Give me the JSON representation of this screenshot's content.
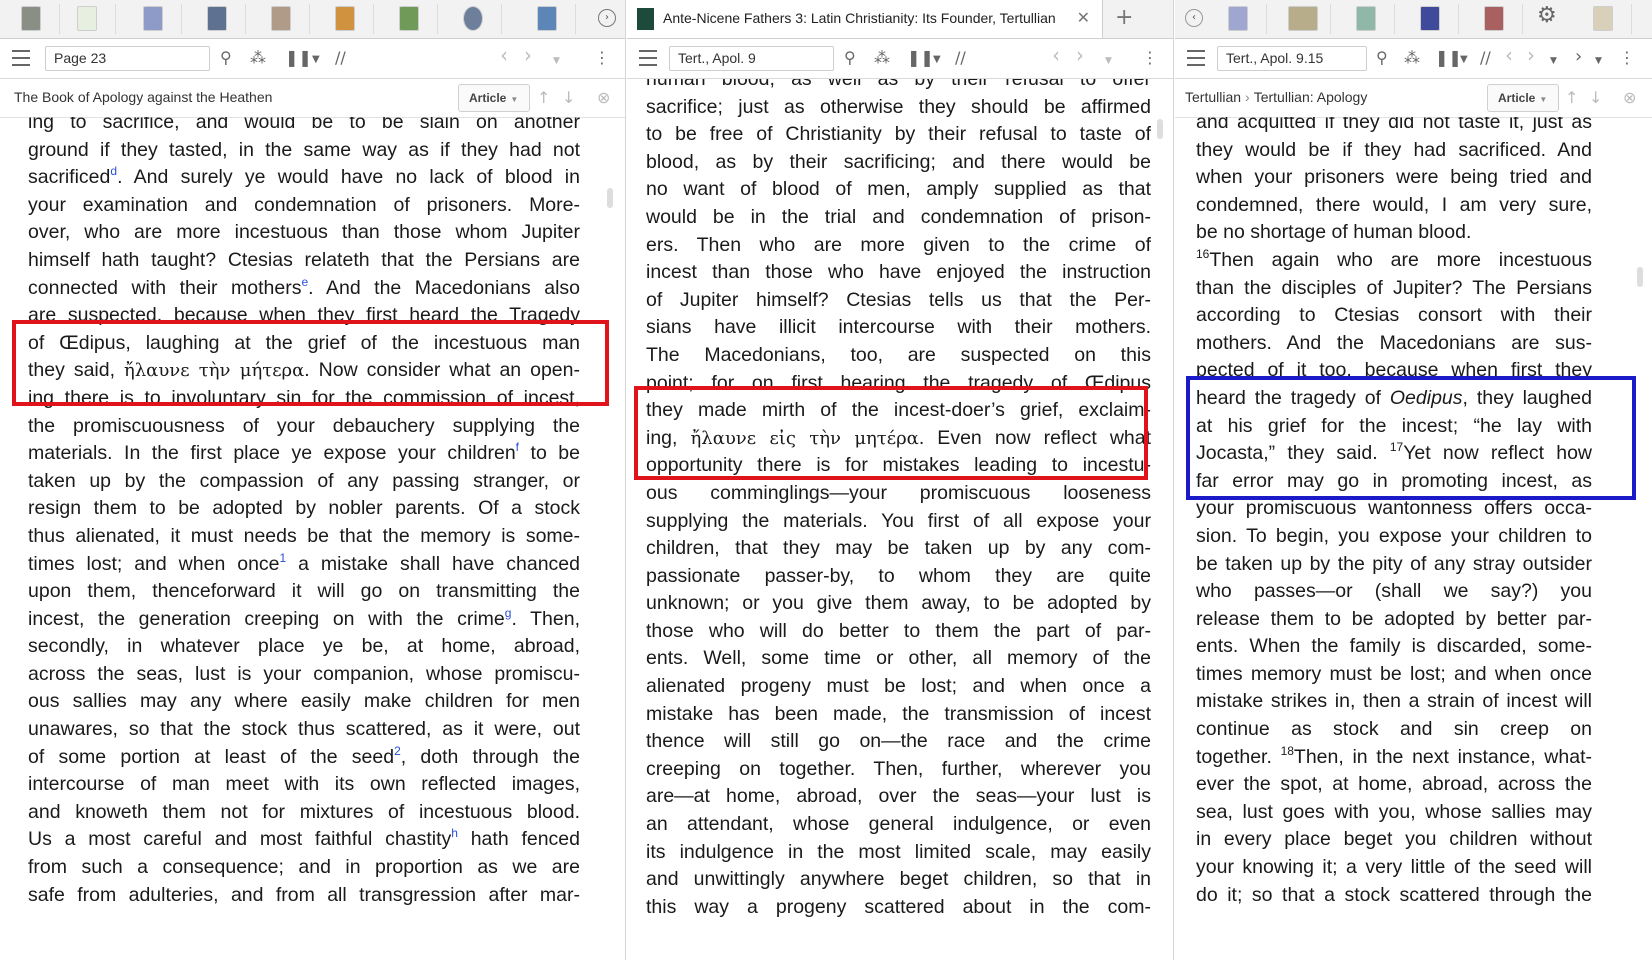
{
  "left": {
    "reference": "Page 23",
    "header_title": "The Book of Apology against the Heathen",
    "view_label": "Article",
    "lines": [
      [
        {
          "t": "ing to sacrifice, and would be to be slain on another"
        }
      ],
      [
        {
          "t": "ground if they tasted, in the same way as if they had not"
        }
      ],
      [
        {
          "t": "sacrificed"
        },
        {
          "t": "d",
          "sup": true
        },
        {
          "t": ". And surely ye would have no lack of blood in"
        }
      ],
      [
        {
          "t": "your examination and condemnation of prisoners. More-"
        }
      ],
      [
        {
          "t": "over, who are more incestuous than those whom Jupiter"
        }
      ],
      [
        {
          "t": "himself hath taught? Ctesias relateth that the Persians are"
        }
      ],
      [
        {
          "t": "connected with their mothers"
        },
        {
          "t": "e",
          "sup": true
        },
        {
          "t": ". And the Macedonians also"
        }
      ],
      [
        {
          "t": "are suspected, because when they first heard the Tragedy"
        }
      ],
      [
        {
          "t": "of Œdipus, laughing at the grief of the incestuous man"
        }
      ],
      [
        {
          "t": "they said, "
        },
        {
          "t": "ἤλαυνε τὴν μήτερα",
          "greek": true
        },
        {
          "t": ". Now consider what an open-"
        }
      ],
      [
        {
          "t": "ing there is to involuntary sin for the commission of incest,"
        }
      ],
      [
        {
          "t": "the promiscuousness of your debauchery supplying the"
        }
      ],
      [
        {
          "t": "materials. In the first place ye expose your children"
        },
        {
          "t": "f",
          "sup": true
        },
        {
          "t": " to be"
        }
      ],
      [
        {
          "t": "taken up by the compassion of any passing stranger, or"
        }
      ],
      [
        {
          "t": "resign them to be adopted by nobler parents. Of a stock"
        }
      ],
      [
        {
          "t": "thus alienated, it must needs be that the memory is some-"
        }
      ],
      [
        {
          "t": "times lost; and when once"
        },
        {
          "t": "1",
          "sup": true
        },
        {
          "t": " a mistake shall have chanced"
        }
      ],
      [
        {
          "t": "upon them, thenceforward it will go on transmitting the"
        }
      ],
      [
        {
          "t": "incest, the generation creeping on with the crime"
        },
        {
          "t": "g",
          "sup": true
        },
        {
          "t": ". Then,"
        }
      ],
      [
        {
          "t": "secondly, in whatever place ye be, at home, abroad,"
        }
      ],
      [
        {
          "t": "across the seas, lust is your companion, whose promiscu-"
        }
      ],
      [
        {
          "t": "ous sallies may any where easily make children for men"
        }
      ],
      [
        {
          "t": "unawares, so that the stock thus scattered, as it were, out"
        }
      ],
      [
        {
          "t": "of some portion at least of the seed"
        },
        {
          "t": "2",
          "sup": true
        },
        {
          "t": ", doth through the"
        }
      ],
      [
        {
          "t": "intercourse of man meet with its own reflected images,"
        }
      ],
      [
        {
          "t": "and knoweth them not for mixtures of incestuous blood."
        }
      ],
      [
        {
          "t": "Us a most careful and most faithful chastity"
        },
        {
          "t": "h",
          "sup": true
        },
        {
          "t": " hath fenced"
        }
      ],
      [
        {
          "t": "from such a consequence; and in proportion as we are"
        }
      ],
      [
        {
          "t": "safe from adulteries, and from all transgression after mar-"
        }
      ]
    ]
  },
  "middle": {
    "tab_title": "Ante-Nicene Fathers 3: Latin Christianity: Its Founder, Tertullian",
    "reference": "Tert., Apol. 9",
    "lines": [
      [
        {
          "t": "human blood, as well as by their refusal to offer"
        }
      ],
      [
        {
          "t": "sacrifice; just as otherwise they should be affirmed"
        }
      ],
      [
        {
          "t": "to be free of Christianity by their refusal to taste of"
        }
      ],
      [
        {
          "t": "blood, as by their sacrificing; and there would be"
        }
      ],
      [
        {
          "t": "no want of blood of men, amply supplied as that"
        }
      ],
      [
        {
          "t": "would be in the trial and condemnation of prison-"
        }
      ],
      [
        {
          "t": "ers. Then who are more given to the crime of"
        }
      ],
      [
        {
          "t": "incest than those who have enjoyed the instruction"
        }
      ],
      [
        {
          "t": "of Jupiter himself? Ctesias tells us that the Per-"
        }
      ],
      [
        {
          "t": "sians have illicit intercourse with their mothers."
        }
      ],
      [
        {
          "t": "The Macedonians, too, are suspected on this"
        }
      ],
      [
        {
          "t": "point; for on first hearing the tragedy of Œdipus"
        }
      ],
      [
        {
          "t": "they made mirth of the incest-doer’s grief, exclaim-"
        }
      ],
      [
        {
          "t": "ing, "
        },
        {
          "t": "ἤλαυνε εἰς τὴν μητέρα",
          "greek": true
        },
        {
          "t": ". Even now reflect what"
        }
      ],
      [
        {
          "t": "opportunity there is for mistakes leading to incestu-"
        }
      ],
      [
        {
          "t": "ous comminglings—your promiscuous looseness"
        }
      ],
      [
        {
          "t": "supplying the materials. You first of all expose your"
        }
      ],
      [
        {
          "t": "children, that they may be taken up by any com-"
        }
      ],
      [
        {
          "t": "passionate passer-by, to whom they are quite"
        }
      ],
      [
        {
          "t": "unknown; or you give them away, to be adopted by"
        }
      ],
      [
        {
          "t": "those who will do better to them the part of par-"
        }
      ],
      [
        {
          "t": "ents. Well, some time or other, all memory of the"
        }
      ],
      [
        {
          "t": "alienated progeny must be lost; and when once a"
        }
      ],
      [
        {
          "t": "mistake has been made, the transmission of incest"
        }
      ],
      [
        {
          "t": "thence will still go on—the race and the crime"
        }
      ],
      [
        {
          "t": "creeping on together. Then, further, wherever you"
        }
      ],
      [
        {
          "t": "are—at home, abroad, over the seas—your lust is"
        }
      ],
      [
        {
          "t": "an attendant, whose general indulgence, or even"
        }
      ],
      [
        {
          "t": "its indulgence in the most limited scale, may easily"
        }
      ],
      [
        {
          "t": "and unwittingly anywhere beget children, so that in"
        }
      ],
      [
        {
          "t": "this way a progeny scattered about in the com-"
        }
      ]
    ]
  },
  "right": {
    "reference": "Tert., Apol. 9.15",
    "breadcrumb": [
      "Tertullian",
      "Tertullian: Apology"
    ],
    "view_label": "Article",
    "lines": [
      [
        {
          "t": "and acquitted if they did not taste it, just as"
        }
      ],
      [
        {
          "t": "they would be if they had sacrificed. And"
        }
      ],
      [
        {
          "t": "when your prisoners were being tried and"
        }
      ],
      [
        {
          "t": "condemned, there would, I am very sure,"
        }
      ],
      [
        {
          "t": "be no shortage of human blood.",
          "last": true
        }
      ],
      [
        {
          "t": "16",
          "sup": true,
          "plain": true
        },
        {
          "t": "Then again who are more incestuous"
        }
      ],
      [
        {
          "t": "than the disciples of Jupiter? The Persians"
        }
      ],
      [
        {
          "t": "according to Ctesias consort with their"
        }
      ],
      [
        {
          "t": "mothers. And the Macedonians are sus-"
        }
      ],
      [
        {
          "t": "pected of it too, because when first they"
        }
      ],
      [
        {
          "t": "heard the tragedy of "
        },
        {
          "t": "Oedipus",
          "it": true
        },
        {
          "t": ", they laughed"
        }
      ],
      [
        {
          "t": "at his grief for the incest; “he lay with"
        }
      ],
      [
        {
          "t": "Jocasta,” they said. "
        },
        {
          "t": "17",
          "sup": true,
          "plain": true
        },
        {
          "t": "Yet now reflect how"
        }
      ],
      [
        {
          "t": "far error may go in promoting incest, as"
        }
      ],
      [
        {
          "t": "your promiscuous wantonness offers occa-"
        }
      ],
      [
        {
          "t": "sion. To begin, you expose your children to"
        }
      ],
      [
        {
          "t": "be taken up by the pity of any stray outsider"
        }
      ],
      [
        {
          "t": "who passes—or (shall we say?) you"
        }
      ],
      [
        {
          "t": "release them to be adopted by better par-"
        }
      ],
      [
        {
          "t": "ents. When the family is discarded, some-"
        }
      ],
      [
        {
          "t": "times memory must be lost; and when once"
        }
      ],
      [
        {
          "t": "mistake strikes in, then a strain of incest will"
        }
      ],
      [
        {
          "t": "continue as stock and sin creep on"
        }
      ],
      [
        {
          "t": "together. "
        },
        {
          "t": "18",
          "sup": true,
          "plain": true
        },
        {
          "t": "Then, in the next instance, what-"
        }
      ],
      [
        {
          "t": "ever the spot, at home, abroad, across the"
        }
      ],
      [
        {
          "t": "sea, lust goes with you, whose sallies may"
        }
      ],
      [
        {
          "t": "in every place beget you children without"
        }
      ],
      [
        {
          "t": "your knowing it; a very little of the seed will"
        }
      ],
      [
        {
          "t": "do it; so that a stock scattered through the"
        }
      ]
    ]
  },
  "colors": {
    "highlight_red": "#e0131a",
    "highlight_blue": "#1a1ac8",
    "footnote_blue": "#2a4fd6"
  }
}
